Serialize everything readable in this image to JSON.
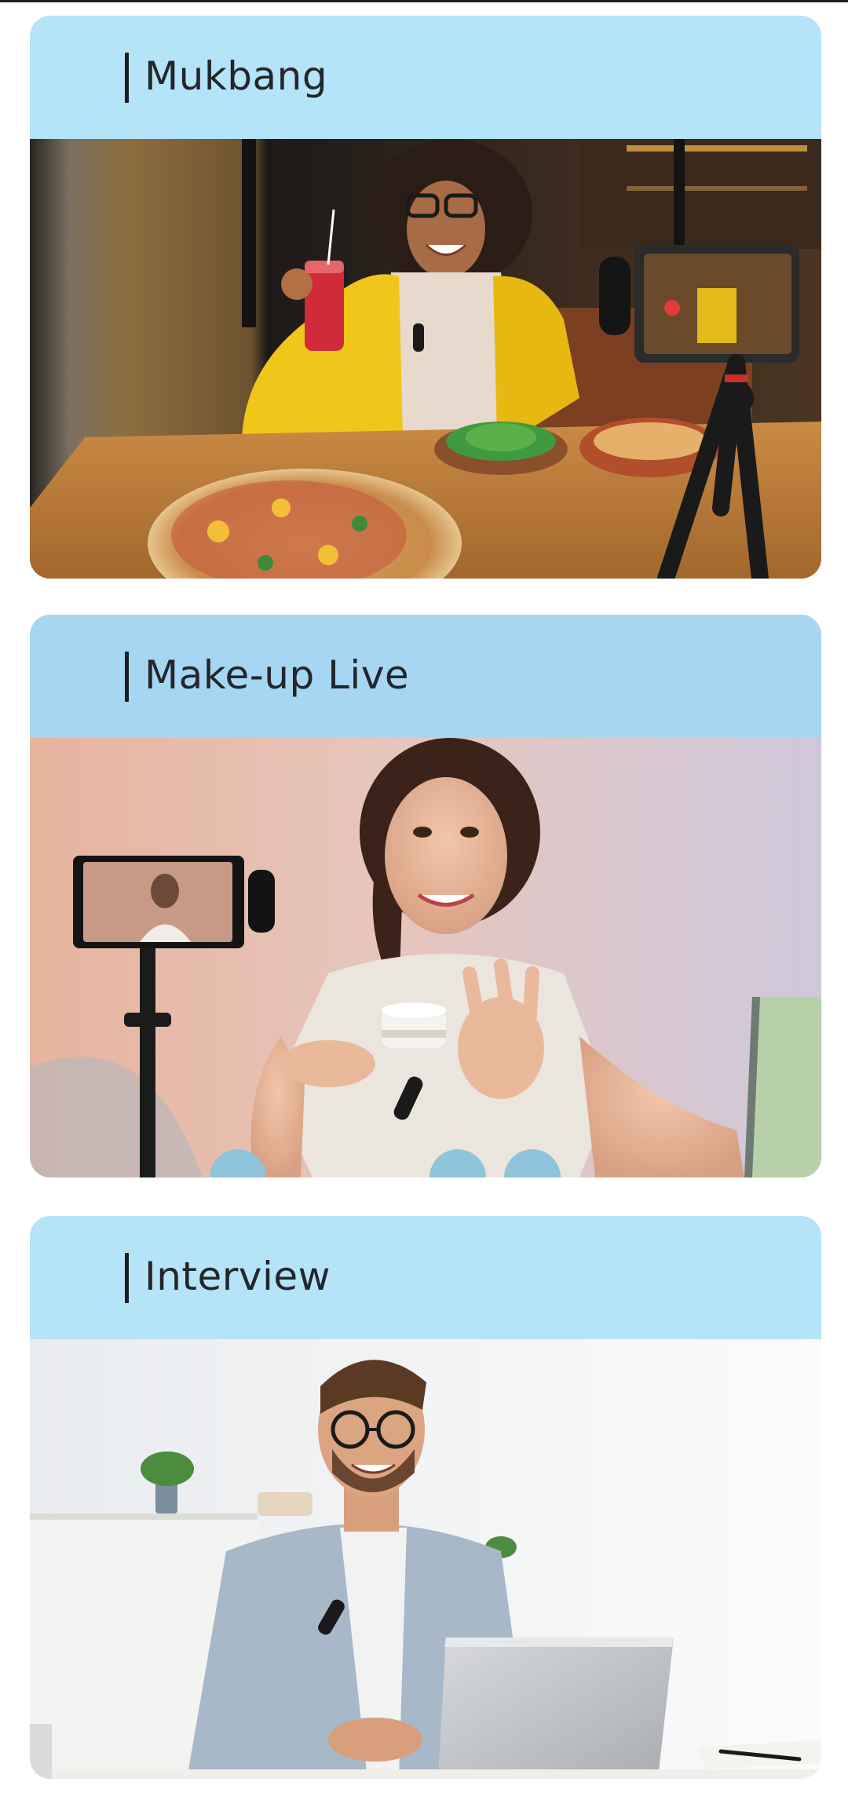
{
  "sections": [
    {
      "title": "Mukbang",
      "header_color": "#b5e3f7",
      "image": "woman-eating-pizza-filming-with-phone-and-wireless-microphone"
    },
    {
      "title": "Make-up Live",
      "header_color": "#a7d6f3",
      "image": "woman-presenting-cream-jar-on-phone-livestream"
    },
    {
      "title": "Interview",
      "header_color": "#b5e3f7",
      "image": "man-with-glasses-at-laptop-wearing-clip-microphone"
    }
  ]
}
